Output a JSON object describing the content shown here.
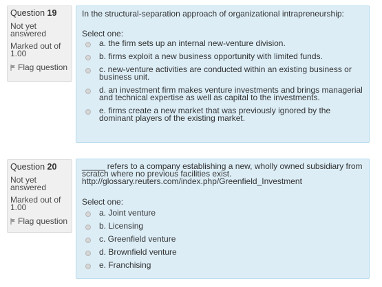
{
  "questions": [
    {
      "number_label": "Question",
      "number": "19",
      "state": "Not yet answered",
      "grade": "Marked out of 1.00",
      "flag_label": "Flag question",
      "text": "In the structural-separation approach of organizational intrapreneurship:",
      "prompt": "Select one:",
      "options": [
        "a. the firm sets up an internal new-venture division.",
        "b. firms exploit a new business opportunity with limited funds.",
        "c. new-venture activities are conducted within an existing business or business unit.",
        "d. an investment firm makes venture investments and brings managerial and technical expertise as well as capital to the investments.",
        "e. firms create a new market that was previously ignored by the dominant players of the existing market."
      ]
    },
    {
      "number_label": "Question",
      "number": "20",
      "state": "Not yet answered",
      "grade": "Marked out of 1.00",
      "flag_label": "Flag question",
      "text": "_____ refers to a company establishing a new, wholly owned subsidiary from scratch where no previous facilities exist. http://glossary.reuters.com/index.php/Greenfield_Investment",
      "prompt": "Select one:",
      "options": [
        "a. Joint venture",
        "b. Licensing",
        "c. Greenfield venture",
        "d. Brownfield venture",
        "e. Franchising"
      ]
    }
  ]
}
